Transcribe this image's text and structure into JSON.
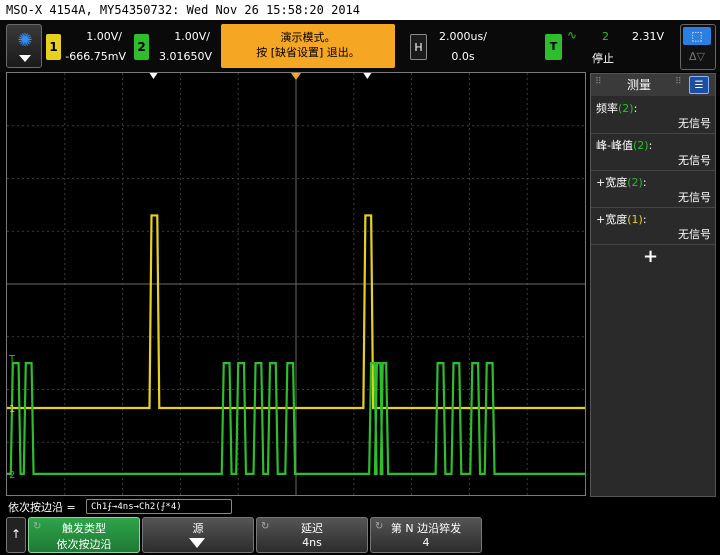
{
  "window_title": "MSO-X 4154A, MY54350732: Wed Nov 26 15:58:20 2014",
  "channels": {
    "ch1": {
      "number": "1",
      "scale": "1.00V/",
      "offset": "-666.75mV",
      "color": "#e6d21e"
    },
    "ch2": {
      "number": "2",
      "scale": "1.00V/",
      "offset": "3.01650V",
      "color": "#2dbd2d"
    }
  },
  "demo_message": {
    "line1": "演示模式。",
    "line2": "按 [缺省设置] 退出。"
  },
  "horizontal": {
    "badge": "H",
    "scale": "2.000us/",
    "delay": "0.0s"
  },
  "trigger": {
    "badge": "T",
    "icon": "∿",
    "source": "2",
    "level": "2.31V",
    "state": "停止"
  },
  "zoom": {
    "top_icon": "⬚",
    "bottom_icon": "Δ▽"
  },
  "menu_icon": "✺",
  "side_panel": {
    "title": "测量",
    "add_label": "+",
    "measurements": [
      {
        "name": "频率",
        "source": "(2)",
        "value": "无信号"
      },
      {
        "name": "峰-峰值",
        "source": "(2)",
        "value": "无信号"
      },
      {
        "name": "+宽度",
        "source": "(2)",
        "value": "无信号"
      },
      {
        "name": "+宽度",
        "source": "(1)",
        "value": "无信号"
      }
    ]
  },
  "status": {
    "label": "依次按边沿 =",
    "sequence": "Ch1⨍→4ns→Ch2(⨍*4)"
  },
  "softkeys": {
    "back": "↑",
    "k1": {
      "title": "触发类型",
      "value": "依次按边沿"
    },
    "k2": {
      "title": "源"
    },
    "k3": {
      "title": "延迟",
      "value": "4ns"
    },
    "k4": {
      "title": "第 N 边沿猝发",
      "value": "4"
    }
  },
  "markers": {
    "ch1": "1",
    "ch2": "2",
    "trigger": "T"
  },
  "waveforms": {
    "ch1": {
      "color": "#e6d21e",
      "baseline_div": 6.35,
      "high_div": 2.7,
      "pulses_us": [
        [
          -5.0,
          -4.8
        ],
        [
          2.4,
          2.6
        ]
      ]
    },
    "ch2": {
      "color": "#2dbd2d",
      "low_div": 1.2,
      "high_div": 3.6,
      "pulses_us": [
        [
          -9.8,
          -9.6
        ],
        [
          -9.35,
          -9.15
        ],
        [
          -2.5,
          -2.3
        ],
        [
          -2.0,
          -1.8
        ],
        [
          -1.4,
          -1.2
        ],
        [
          -0.9,
          -0.7
        ],
        [
          -0.3,
          -0.1
        ],
        [
          2.6,
          2.72
        ],
        [
          2.8,
          2.92
        ],
        [
          3.0,
          3.12
        ],
        [
          4.9,
          5.1
        ],
        [
          5.45,
          5.65
        ],
        [
          6.1,
          6.3
        ],
        [
          6.6,
          6.8
        ]
      ]
    }
  }
}
